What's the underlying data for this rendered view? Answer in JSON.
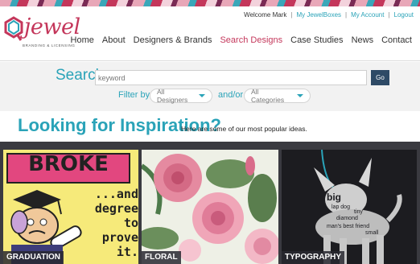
{
  "brand": {
    "name": "jewel",
    "tagline": "BRANDING & LICENSING",
    "colors": {
      "accent": "#2aa3b8",
      "brand": "#c4375b",
      "nav_active": "#c4375b",
      "go_button": "#2e4a66"
    }
  },
  "utility": {
    "welcome": "Welcome Mark",
    "links": [
      "My JewelBoxes",
      "My Account",
      "Logout"
    ]
  },
  "nav": {
    "items": [
      "Home",
      "About",
      "Designers & Brands",
      "Search Designs",
      "Case Studies",
      "News",
      "Contact"
    ],
    "active": "Search Designs"
  },
  "search": {
    "label": "Search",
    "placeholder": "keyword",
    "go_label": "Go",
    "filter_label": "Filter by",
    "andor_label": "and/or",
    "designers_value": "All Designers",
    "categories_value": "All Categories"
  },
  "inspiration": {
    "title": "Looking for Inspiration?",
    "subtitle": "Here are some of our most popular ideas."
  },
  "gallery": {
    "cards": [
      {
        "label": "GRADUATION",
        "headline": "BROKE",
        "body": "...and degree to prove it."
      },
      {
        "label": "FLORAL"
      },
      {
        "label": "TYPOGRAPHY",
        "words": [
          "big",
          "diamond",
          "man's best friend",
          "lap dog",
          "small",
          "tiny"
        ]
      }
    ]
  },
  "icons": {
    "logo": "jewel-logo-icon",
    "caret": "chevron-down-icon"
  }
}
